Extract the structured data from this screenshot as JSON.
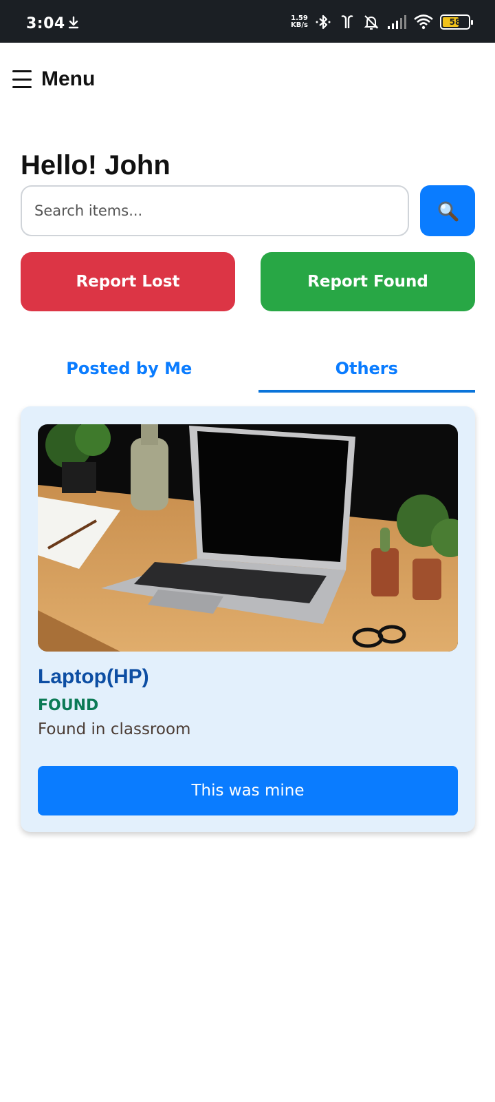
{
  "status_bar": {
    "time": "3:04",
    "net_speed_value": "1.59",
    "net_speed_unit": "KB/s",
    "battery_level": "58",
    "icons": [
      "download-icon",
      "bluetooth-icon",
      "earbuds-icon",
      "bell-muted-icon",
      "signal-icon",
      "wifi-icon",
      "battery-icon"
    ]
  },
  "header": {
    "menu_label": "Menu"
  },
  "greeting": "Hello! John",
  "search": {
    "placeholder": "Search items...",
    "value": ""
  },
  "actions": {
    "report_lost": "Report Lost",
    "report_found": "Report Found"
  },
  "tabs": [
    {
      "label": "Posted by Me",
      "active": false
    },
    {
      "label": "Others",
      "active": true
    }
  ],
  "items": [
    {
      "title": "Laptop(HP)",
      "status": "FOUND",
      "description": "Found in classroom",
      "claim_label": "This was mine"
    }
  ],
  "colors": {
    "primary": "#0a7cff",
    "danger": "#dc3545",
    "success": "#28a745",
    "card_bg": "#e3f0fc",
    "title": "#0d4ea3",
    "status_found": "#0b7a55"
  }
}
